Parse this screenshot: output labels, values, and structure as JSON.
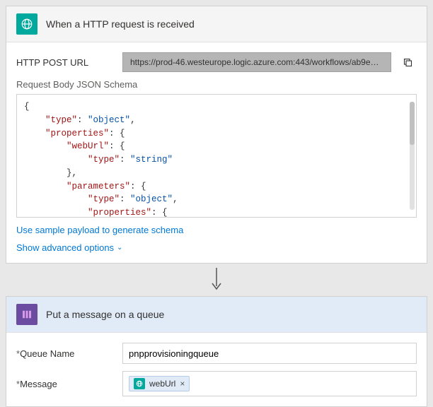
{
  "trigger": {
    "title": "When a HTTP request is received",
    "url_label": "HTTP POST URL",
    "url_value": "https://prod-46.westeurope.logic.azure.com:443/workflows/ab9e0ced...",
    "schema_label": "Request Body JSON Schema",
    "schema_json": {
      "lines": [
        {
          "indent": 0,
          "raw": "{"
        },
        {
          "indent": 1,
          "key": "type",
          "val": "object",
          "comma": true
        },
        {
          "indent": 1,
          "key": "properties",
          "open": true
        },
        {
          "indent": 2,
          "key": "webUrl",
          "open": true
        },
        {
          "indent": 3,
          "key": "type",
          "val": "string"
        },
        {
          "indent": 2,
          "close": true,
          "comma": true
        },
        {
          "indent": 2,
          "key": "parameters",
          "open": true
        },
        {
          "indent": 3,
          "key": "type",
          "val": "object",
          "comma": true
        },
        {
          "indent": 3,
          "key": "properties",
          "open": true
        }
      ]
    },
    "sample_link": "Use sample payload to generate schema",
    "advanced_link": "Show advanced options"
  },
  "action": {
    "title": "Put a message on a queue",
    "queue_label": "Queue Name",
    "queue_value": "pnpprovisioningqueue",
    "message_label": "Message",
    "message_token": "webUrl"
  }
}
